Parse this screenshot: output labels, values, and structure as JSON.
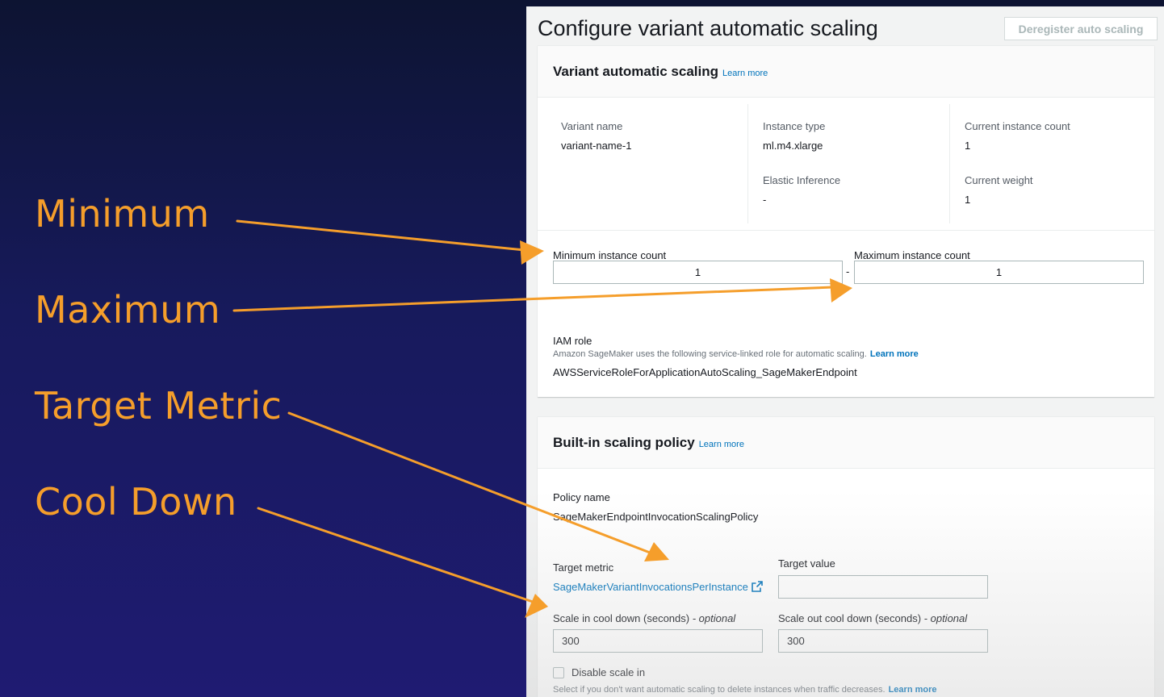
{
  "annotations": {
    "minimum": "Minimum",
    "maximum": "Maximum",
    "target_metric": "Target Metric",
    "cool_down": "Cool Down"
  },
  "console": {
    "page_title": "Configure variant automatic scaling",
    "deregister_button": "Deregister auto scaling",
    "variant_panel": {
      "title": "Variant automatic scaling",
      "learn_more": "Learn more",
      "variant_name_label": "Variant name",
      "variant_name_value": "variant-name-1",
      "instance_type_label": "Instance type",
      "instance_type_value": "ml.m4.xlarge",
      "elastic_inference_label": "Elastic Inference",
      "elastic_inference_value": "-",
      "current_instance_count_label": "Current instance count",
      "current_instance_count_value": "1",
      "current_weight_label": "Current weight",
      "current_weight_value": "1",
      "min_instance_label": "Minimum instance count",
      "min_instance_value": "1",
      "range_separator": "-",
      "max_instance_label": "Maximum instance count",
      "max_instance_value": "1",
      "iam_role_label": "IAM role",
      "iam_role_desc": "Amazon SageMaker uses the following service-linked role for automatic scaling.",
      "iam_learn_more": "Learn more",
      "iam_role_value": "AWSServiceRoleForApplicationAutoScaling_SageMakerEndpoint"
    },
    "policy_panel": {
      "title": "Built-in scaling policy",
      "learn_more": "Learn more",
      "policy_name_label": "Policy name",
      "policy_name_value": "SageMakerEndpointInvocationScalingPolicy",
      "target_metric_label": "Target metric",
      "target_metric_value": "SageMakerVariantInvocationsPerInstance",
      "target_value_label": "Target value",
      "target_value_value": "",
      "scale_in_label": "Scale in cool down (seconds)",
      "scale_in_value": "300",
      "scale_out_label": "Scale out cool down (seconds)",
      "scale_out_value": "300",
      "optional_suffix": "- optional",
      "disable_scale_in_label": "Disable scale in",
      "disable_scale_in_desc": "Select if you don't want automatic scaling to delete instances when traffic decreases.",
      "disable_learn_more": "Learn more"
    }
  },
  "colors": {
    "annotation_orange": "#f59e2b",
    "background_navy": "#171a5c",
    "link_blue": "#0073bb"
  },
  "icons": {
    "external_link": "external-link-icon",
    "arrow": "orange-arrow"
  }
}
